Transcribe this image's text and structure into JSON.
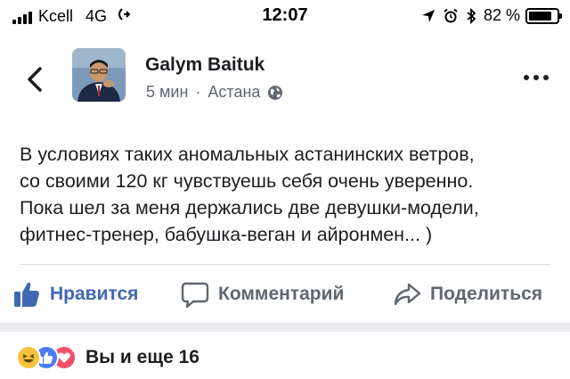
{
  "status_bar": {
    "carrier": "Kcell",
    "network": "4G",
    "time": "12:07",
    "battery_percent": "82 %",
    "battery_level": 0.82,
    "icons": [
      "signal-bars-icon",
      "call-forwarding-icon",
      "location-arrow-icon",
      "alarm-icon",
      "bluetooth-icon",
      "battery-icon"
    ]
  },
  "post": {
    "author": "Galym Baituk",
    "time_ago": "5 мин",
    "separator": "·",
    "location": "Астана",
    "privacy_icon": "globe-icon",
    "text_lines": [
      "В условиях таких аномальных астанинских ветров,",
      "со своими 120 кг чувствуешь себя очень уверенно.",
      "Пока шел за меня держались две девушки-модели,",
      "фитнес-тренер, бабушка-веган и айронмен... )"
    ]
  },
  "actions": {
    "like_label": "Нравится",
    "comment_label": "Комментарий",
    "share_label": "Поделиться"
  },
  "reactions": {
    "types": [
      "haha",
      "like",
      "love"
    ],
    "summary": "Вы и еще 16"
  },
  "colors": {
    "accent": "#4267b2",
    "secondary_text": "#606770",
    "primary_text": "#1c1e21",
    "divider": "#dadde1",
    "separator_band": "#e9ebee",
    "haha": "#f7c33e",
    "like": "#4b7cf3",
    "love": "#f25268"
  }
}
